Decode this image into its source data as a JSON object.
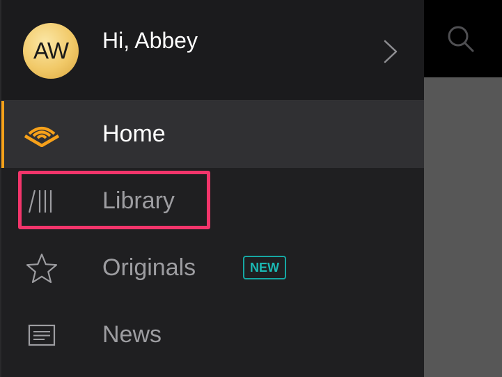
{
  "profile": {
    "initials": "AW",
    "greeting": "Hi, Abbey"
  },
  "nav": {
    "items": [
      {
        "label": "Home",
        "icon": "audible-logo-icon",
        "active": true
      },
      {
        "label": "Library",
        "icon": "library-icon",
        "active": false
      },
      {
        "label": "Originals",
        "icon": "star-icon",
        "active": false,
        "badge": "NEW"
      },
      {
        "label": "News",
        "icon": "news-icon",
        "active": false
      }
    ]
  },
  "colors": {
    "accent": "#f7a11a",
    "badge": "#16a7a3",
    "highlight": "#f2356b",
    "drawer_bg": "#1f1f21",
    "active_bg": "#303033"
  }
}
